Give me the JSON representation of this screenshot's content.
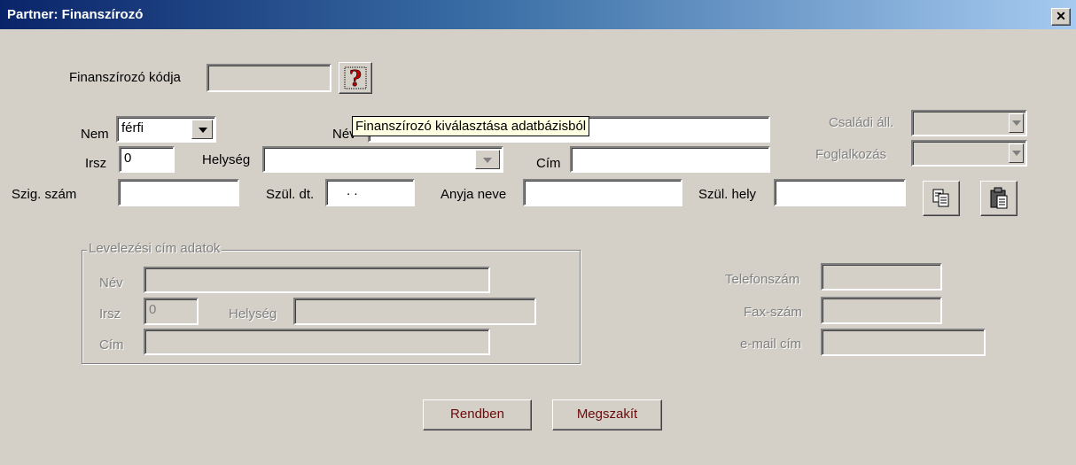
{
  "window": {
    "title": "Partner: Finanszírozó",
    "close_icon": "✕"
  },
  "finanszirozo": {
    "code_label": "Finanszírozó kódja",
    "code_value": "",
    "lookup_icon": "question-icon"
  },
  "tooltip": "Finanszírozó kiválasztása adatbázisból",
  "person": {
    "nem_label": "Nem",
    "nem_value": "férfi",
    "nev_label": "Név",
    "nev_value": "",
    "irsz_label": "Irsz",
    "irsz_value": "0",
    "helyseg_label": "Helység",
    "helyseg_value": "",
    "cim_label": "Cím",
    "cim_value": "",
    "szig_label": "Szig. szám",
    "szig_value": "",
    "szul_dt_label": "Szül. dt.",
    "szul_dt_value": ". .",
    "anyja_label": "Anyja neve",
    "anyja_value": "",
    "szul_hely_label": "Szül. hely",
    "szul_hely_value": "",
    "csaladi_label": "Családi áll.",
    "csaladi_value": "",
    "foglalkozas_label": "Foglalkozás",
    "foglalkozas_value": ""
  },
  "levelezesi": {
    "group_title": "Levelezési cím adatok",
    "nev_label": "Név",
    "nev_value": "",
    "irsz_label": "Irsz",
    "irsz_value": "0",
    "helyseg_label": "Helység",
    "helyseg_value": "",
    "cim_label": "Cím",
    "cim_value": ""
  },
  "contact": {
    "telefon_label": "Telefonszám",
    "telefon_value": "",
    "fax_label": "Fax-szám",
    "fax_value": "",
    "email_label": "e-mail cím",
    "email_value": ""
  },
  "buttons": {
    "ok": "Rendben",
    "cancel": "Megszakít"
  },
  "icons": {
    "copy": "copy-icon",
    "paste": "paste-icon"
  }
}
